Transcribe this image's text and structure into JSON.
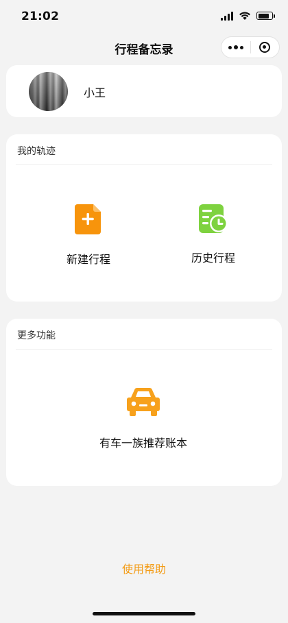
{
  "status_bar": {
    "time": "21:02",
    "icons": [
      "cellular-signal-icon",
      "wifi-icon",
      "battery-icon"
    ]
  },
  "nav": {
    "title": "行程备忘录",
    "capsule_icons": [
      "more-dots-icon",
      "close-miniprogram-icon"
    ]
  },
  "profile": {
    "name": "小王",
    "avatar_icon": "avatar-photo"
  },
  "track_section": {
    "title": "我的轨迹",
    "items": [
      {
        "label": "新建行程",
        "icon": "new-document-plus-icon",
        "color": "#f7940c"
      },
      {
        "label": "历史行程",
        "icon": "history-clock-list-icon",
        "color": "#7ed23f"
      }
    ]
  },
  "more_section": {
    "title": "更多功能",
    "items": [
      {
        "label": "有车一族推荐账本",
        "icon": "car-icon",
        "color": "#f7a11c"
      }
    ]
  },
  "footer": {
    "help_label": "使用帮助",
    "help_color": "#f39b14"
  }
}
